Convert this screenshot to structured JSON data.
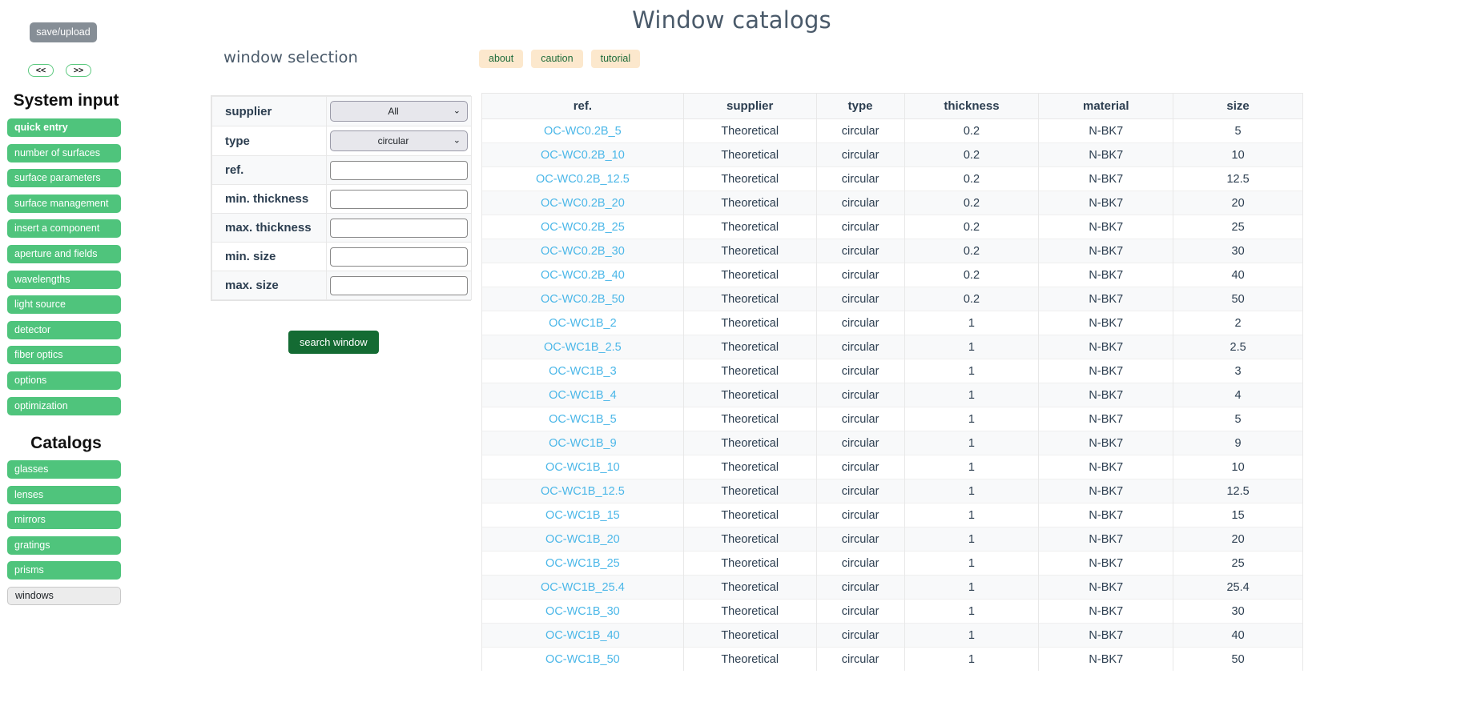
{
  "sidebar": {
    "save_upload_label": "save/upload",
    "nav_prev_label": "<<",
    "nav_next_label": ">>",
    "system_input_title": "System input",
    "system_items": [
      {
        "label": "quick entry",
        "state": "bold"
      },
      {
        "label": "number of surfaces",
        "state": "normal"
      },
      {
        "label": "surface parameters",
        "state": "normal"
      },
      {
        "label": "surface management",
        "state": "normal"
      },
      {
        "label": "insert a component",
        "state": "normal"
      },
      {
        "label": "aperture and fields",
        "state": "normal"
      },
      {
        "label": "wavelengths",
        "state": "normal"
      },
      {
        "label": "light source",
        "state": "normal"
      },
      {
        "label": "detector",
        "state": "normal"
      },
      {
        "label": "fiber optics",
        "state": "normal"
      },
      {
        "label": "options",
        "state": "normal"
      },
      {
        "label": "optimization",
        "state": "normal"
      }
    ],
    "catalogs_title": "Catalogs",
    "catalog_items": [
      {
        "label": "glasses",
        "state": "normal"
      },
      {
        "label": "lenses",
        "state": "normal"
      },
      {
        "label": "mirrors",
        "state": "normal"
      },
      {
        "label": "gratings",
        "state": "normal"
      },
      {
        "label": "prisms",
        "state": "normal"
      },
      {
        "label": "windows",
        "state": "active"
      }
    ]
  },
  "header": {
    "page_title": "Window catalogs",
    "section_title": "window selection",
    "help_buttons": [
      {
        "label": "about"
      },
      {
        "label": "caution"
      },
      {
        "label": "tutorial"
      }
    ]
  },
  "search_form": {
    "rows": [
      {
        "label": "supplier",
        "type": "select",
        "value": "All"
      },
      {
        "label": "type",
        "type": "select",
        "value": "circular"
      },
      {
        "label": "ref.",
        "type": "text",
        "value": "",
        "placeholder": ""
      },
      {
        "label": "min. thickness",
        "type": "text",
        "value": "",
        "placeholder": ""
      },
      {
        "label": "max. thickness",
        "type": "text",
        "value": "",
        "placeholder": ""
      },
      {
        "label": "min. size",
        "type": "text",
        "value": "",
        "placeholder": ""
      },
      {
        "label": "max. size",
        "type": "text",
        "value": "",
        "placeholder": ""
      }
    ],
    "supplier_options": [
      "All"
    ],
    "type_options": [
      "circular"
    ],
    "search_button_label": "search window"
  },
  "results": {
    "columns": [
      "ref.",
      "supplier",
      "type",
      "thickness",
      "material",
      "size"
    ],
    "rows": [
      {
        "ref": "OC-WC0.2B_5",
        "supplier": "Theoretical",
        "type": "circular",
        "thickness": "0.2",
        "material": "N-BK7",
        "size": "5"
      },
      {
        "ref": "OC-WC0.2B_10",
        "supplier": "Theoretical",
        "type": "circular",
        "thickness": "0.2",
        "material": "N-BK7",
        "size": "10"
      },
      {
        "ref": "OC-WC0.2B_12.5",
        "supplier": "Theoretical",
        "type": "circular",
        "thickness": "0.2",
        "material": "N-BK7",
        "size": "12.5"
      },
      {
        "ref": "OC-WC0.2B_20",
        "supplier": "Theoretical",
        "type": "circular",
        "thickness": "0.2",
        "material": "N-BK7",
        "size": "20"
      },
      {
        "ref": "OC-WC0.2B_25",
        "supplier": "Theoretical",
        "type": "circular",
        "thickness": "0.2",
        "material": "N-BK7",
        "size": "25"
      },
      {
        "ref": "OC-WC0.2B_30",
        "supplier": "Theoretical",
        "type": "circular",
        "thickness": "0.2",
        "material": "N-BK7",
        "size": "30"
      },
      {
        "ref": "OC-WC0.2B_40",
        "supplier": "Theoretical",
        "type": "circular",
        "thickness": "0.2",
        "material": "N-BK7",
        "size": "40"
      },
      {
        "ref": "OC-WC0.2B_50",
        "supplier": "Theoretical",
        "type": "circular",
        "thickness": "0.2",
        "material": "N-BK7",
        "size": "50"
      },
      {
        "ref": "OC-WC1B_2",
        "supplier": "Theoretical",
        "type": "circular",
        "thickness": "1",
        "material": "N-BK7",
        "size": "2"
      },
      {
        "ref": "OC-WC1B_2.5",
        "supplier": "Theoretical",
        "type": "circular",
        "thickness": "1",
        "material": "N-BK7",
        "size": "2.5"
      },
      {
        "ref": "OC-WC1B_3",
        "supplier": "Theoretical",
        "type": "circular",
        "thickness": "1",
        "material": "N-BK7",
        "size": "3"
      },
      {
        "ref": "OC-WC1B_4",
        "supplier": "Theoretical",
        "type": "circular",
        "thickness": "1",
        "material": "N-BK7",
        "size": "4"
      },
      {
        "ref": "OC-WC1B_5",
        "supplier": "Theoretical",
        "type": "circular",
        "thickness": "1",
        "material": "N-BK7",
        "size": "5"
      },
      {
        "ref": "OC-WC1B_9",
        "supplier": "Theoretical",
        "type": "circular",
        "thickness": "1",
        "material": "N-BK7",
        "size": "9"
      },
      {
        "ref": "OC-WC1B_10",
        "supplier": "Theoretical",
        "type": "circular",
        "thickness": "1",
        "material": "N-BK7",
        "size": "10"
      },
      {
        "ref": "OC-WC1B_12.5",
        "supplier": "Theoretical",
        "type": "circular",
        "thickness": "1",
        "material": "N-BK7",
        "size": "12.5"
      },
      {
        "ref": "OC-WC1B_15",
        "supplier": "Theoretical",
        "type": "circular",
        "thickness": "1",
        "material": "N-BK7",
        "size": "15"
      },
      {
        "ref": "OC-WC1B_20",
        "supplier": "Theoretical",
        "type": "circular",
        "thickness": "1",
        "material": "N-BK7",
        "size": "20"
      },
      {
        "ref": "OC-WC1B_25",
        "supplier": "Theoretical",
        "type": "circular",
        "thickness": "1",
        "material": "N-BK7",
        "size": "25"
      },
      {
        "ref": "OC-WC1B_25.4",
        "supplier": "Theoretical",
        "type": "circular",
        "thickness": "1",
        "material": "N-BK7",
        "size": "25.4"
      },
      {
        "ref": "OC-WC1B_30",
        "supplier": "Theoretical",
        "type": "circular",
        "thickness": "1",
        "material": "N-BK7",
        "size": "30"
      },
      {
        "ref": "OC-WC1B_40",
        "supplier": "Theoretical",
        "type": "circular",
        "thickness": "1",
        "material": "N-BK7",
        "size": "40"
      },
      {
        "ref": "OC-WC1B_50",
        "supplier": "Theoretical",
        "type": "circular",
        "thickness": "1",
        "material": "N-BK7",
        "size": "50"
      }
    ]
  },
  "colors": {
    "nav_green": "#4fc47c",
    "save_gray": "#868e96",
    "help_peach": "#fce8cd",
    "search_green": "#146b33",
    "link_blue": "#4bb7e8"
  }
}
